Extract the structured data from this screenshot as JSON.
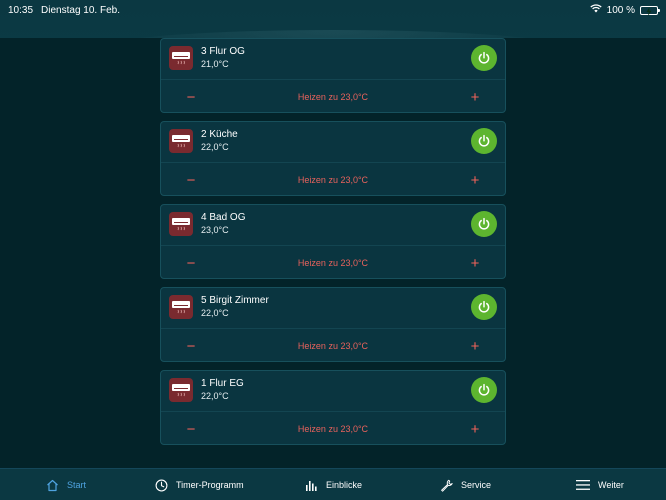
{
  "status_bar": {
    "time": "10:35",
    "date": "Dienstag 10. Feb.",
    "battery": "100 %",
    "icons": [
      "wifi-icon",
      "battery-charging-icon"
    ]
  },
  "devices": [
    {
      "name": "3 Flur OG",
      "temperature": "21,0°C",
      "setpoint_label": "Heizen zu 23,0°C",
      "minus": "−",
      "plus": "+",
      "icon": "radiator-icon"
    },
    {
      "name": "2 Küche",
      "temperature": "22,0°C",
      "setpoint_label": "Heizen zu 23,0°C",
      "minus": "−",
      "plus": "+",
      "icon": "radiator-icon"
    },
    {
      "name": "4 Bad OG",
      "temperature": "23,0°C",
      "setpoint_label": "Heizen zu 23,0°C",
      "minus": "−",
      "plus": "+",
      "icon": "radiator-icon"
    },
    {
      "name": "5 Birgit Zimmer",
      "temperature": "22,0°C",
      "setpoint_label": "Heizen zu 23,0°C",
      "minus": "−",
      "plus": "+",
      "icon": "radiator-icon"
    },
    {
      "name": "1 Flur EG",
      "temperature": "22,0°C",
      "setpoint_label": "Heizen zu 23,0°C",
      "minus": "−",
      "plus": "+",
      "icon": "radiator-icon"
    }
  ],
  "tabs": [
    {
      "label": "Start",
      "icon": "home-icon",
      "active": true
    },
    {
      "label": "Timer-Programm",
      "icon": "clock-icon",
      "active": false
    },
    {
      "label": "Einblicke",
      "icon": "bar-chart-icon",
      "active": false
    },
    {
      "label": "Service",
      "icon": "wrench-icon",
      "active": false
    },
    {
      "label": "Weiter",
      "icon": "menu-icon",
      "active": false
    }
  ],
  "colors": {
    "background": "#032329",
    "card": "#0a3540",
    "accent_red": "#e8625c",
    "power_green": "#5db52f",
    "active_tab": "#4fa3e0"
  }
}
